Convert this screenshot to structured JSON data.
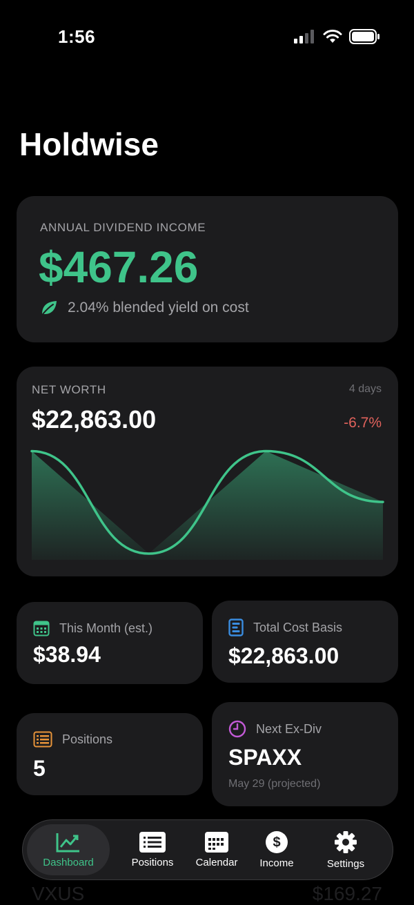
{
  "status_bar": {
    "time": "1:56"
  },
  "app": {
    "title": "Holdwise"
  },
  "annual_income": {
    "label": "ANNUAL DIVIDEND INCOME",
    "value": "$467.26",
    "subtitle": "2.04% blended yield on cost",
    "icon": "leaf-icon"
  },
  "net_worth": {
    "label": "NET WORTH",
    "range": "4 days",
    "value": "$22,863.00",
    "change": "-6.7%"
  },
  "chart_data": {
    "type": "area",
    "x": [
      0,
      1,
      2,
      3
    ],
    "series": [
      {
        "values": [
          24500,
          21200,
          24500,
          22863
        ]
      }
    ],
    "ylim": [
      21000,
      25000
    ],
    "color": "#3fc48a"
  },
  "stats": {
    "this_month": {
      "label": "This Month (est.)",
      "value": "$38.94",
      "icon": "calendar-icon",
      "color": "#3fc48a"
    },
    "cost_basis": {
      "label": "Total Cost Basis",
      "value": "$22,863.00",
      "icon": "document-icon",
      "color": "#3a8de0"
    },
    "positions": {
      "label": "Positions",
      "value": "5",
      "icon": "list-icon",
      "color": "#e8943a"
    },
    "next_exdiv": {
      "label": "Next Ex-Div",
      "value": "SPAXX",
      "note": "May 29 (projected)",
      "icon": "clock-icon",
      "color": "#c25ad6"
    }
  },
  "holdings_preview": {
    "name": "VXUS",
    "value": "$169.27"
  },
  "tabbar": {
    "tabs": [
      {
        "label": "Dashboard",
        "icon": "chart-icon"
      },
      {
        "label": "Positions",
        "icon": "list-icon"
      },
      {
        "label": "Calendar",
        "icon": "calendar-icon"
      },
      {
        "label": "Income",
        "icon": "dollar-icon"
      },
      {
        "label": "Settings",
        "icon": "gear-icon"
      }
    ]
  }
}
